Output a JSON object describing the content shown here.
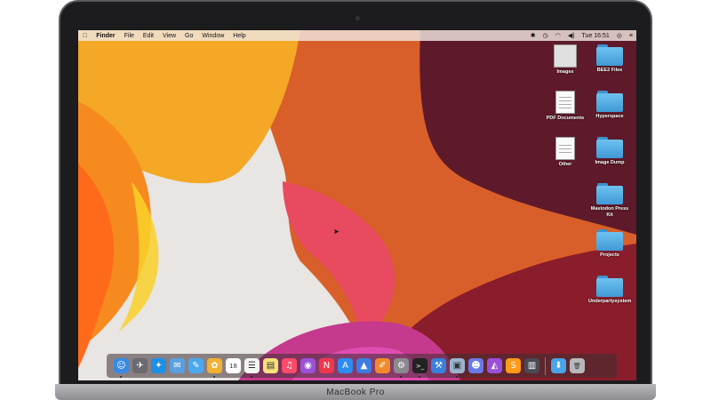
{
  "device_label": "MacBook Pro",
  "menubar": {
    "apple": "",
    "app_name": "Finder",
    "menus": [
      "File",
      "Edit",
      "View",
      "Go",
      "Window",
      "Help"
    ],
    "status_icons": [
      "bluetooth-icon",
      "time-machine-icon",
      "wifi-icon",
      "volume-icon"
    ],
    "clock": "Tue 16:51"
  },
  "desktop_icons": [
    {
      "label": "Images",
      "kind": "image"
    },
    {
      "label": "BEE2 Files",
      "kind": "folder"
    },
    {
      "label": "PDF Documents",
      "kind": "document"
    },
    {
      "label": "Hyperspace",
      "kind": "folder"
    },
    {
      "label": "Other",
      "kind": "document"
    },
    {
      "label": "Image Dump",
      "kind": "folder"
    },
    {
      "label": "Mastodon Press Kit",
      "kind": "folder"
    },
    {
      "label": "Projects",
      "kind": "folder"
    },
    {
      "label": "Underpartysystem",
      "kind": "folder"
    }
  ],
  "dock": {
    "apps": [
      {
        "name": "finder-icon",
        "color": "#3a8be0",
        "glyph": "☺"
      },
      {
        "name": "launchpad-icon",
        "color": "#6a6a70",
        "glyph": "✈"
      },
      {
        "name": "safari-icon",
        "color": "#1e8fe6",
        "glyph": "✦"
      },
      {
        "name": "mail-icon",
        "color": "#5aa0e0",
        "glyph": "✉"
      },
      {
        "name": "messages-icon",
        "color": "#4aa8f0",
        "glyph": "✎"
      },
      {
        "name": "photos-icon",
        "color": "#f2b134",
        "glyph": "✿"
      },
      {
        "name": "calendar-icon",
        "color": "#ffffff",
        "glyph": "18"
      },
      {
        "name": "reminders-icon",
        "color": "#f4f4f4",
        "glyph": "☰"
      },
      {
        "name": "notes-icon",
        "color": "#f6e07a",
        "glyph": "▤"
      },
      {
        "name": "music-icon",
        "color": "#fb4a6a",
        "glyph": "♫"
      },
      {
        "name": "podcasts-icon",
        "color": "#9b52d9",
        "glyph": "◉"
      },
      {
        "name": "news-icon",
        "color": "#f0384c",
        "glyph": "N"
      },
      {
        "name": "app-store-icon",
        "color": "#2e8bf0",
        "glyph": "A"
      },
      {
        "name": "keynote-icon",
        "color": "#3d7de0",
        "glyph": "▲"
      },
      {
        "name": "pages-icon",
        "color": "#f08a2c",
        "glyph": "✐"
      },
      {
        "name": "system-preferences-icon",
        "color": "#8a8a90",
        "glyph": "⚙"
      },
      {
        "name": "terminal-icon",
        "color": "#222222",
        "glyph": ">_"
      },
      {
        "name": "xcode-icon",
        "color": "#3a7fd8",
        "glyph": "⚒"
      },
      {
        "name": "preview-icon",
        "color": "#9ab4d0",
        "glyph": "▣"
      },
      {
        "name": "discord-icon",
        "color": "#6a79e8",
        "glyph": "☻"
      },
      {
        "name": "affinity-icon",
        "color": "#9a4fd8",
        "glyph": "◭"
      },
      {
        "name": "sublime-icon",
        "color": "#ff9a1a",
        "glyph": "S"
      },
      {
        "name": "activity-monitor-icon",
        "color": "#4a4a55",
        "glyph": "▥"
      }
    ],
    "trailing": [
      {
        "name": "downloads-folder-icon",
        "color": "#4aa4e8",
        "glyph": "⬇"
      },
      {
        "name": "trash-icon",
        "color": "#b8b8bc",
        "glyph": "🗑"
      }
    ]
  }
}
